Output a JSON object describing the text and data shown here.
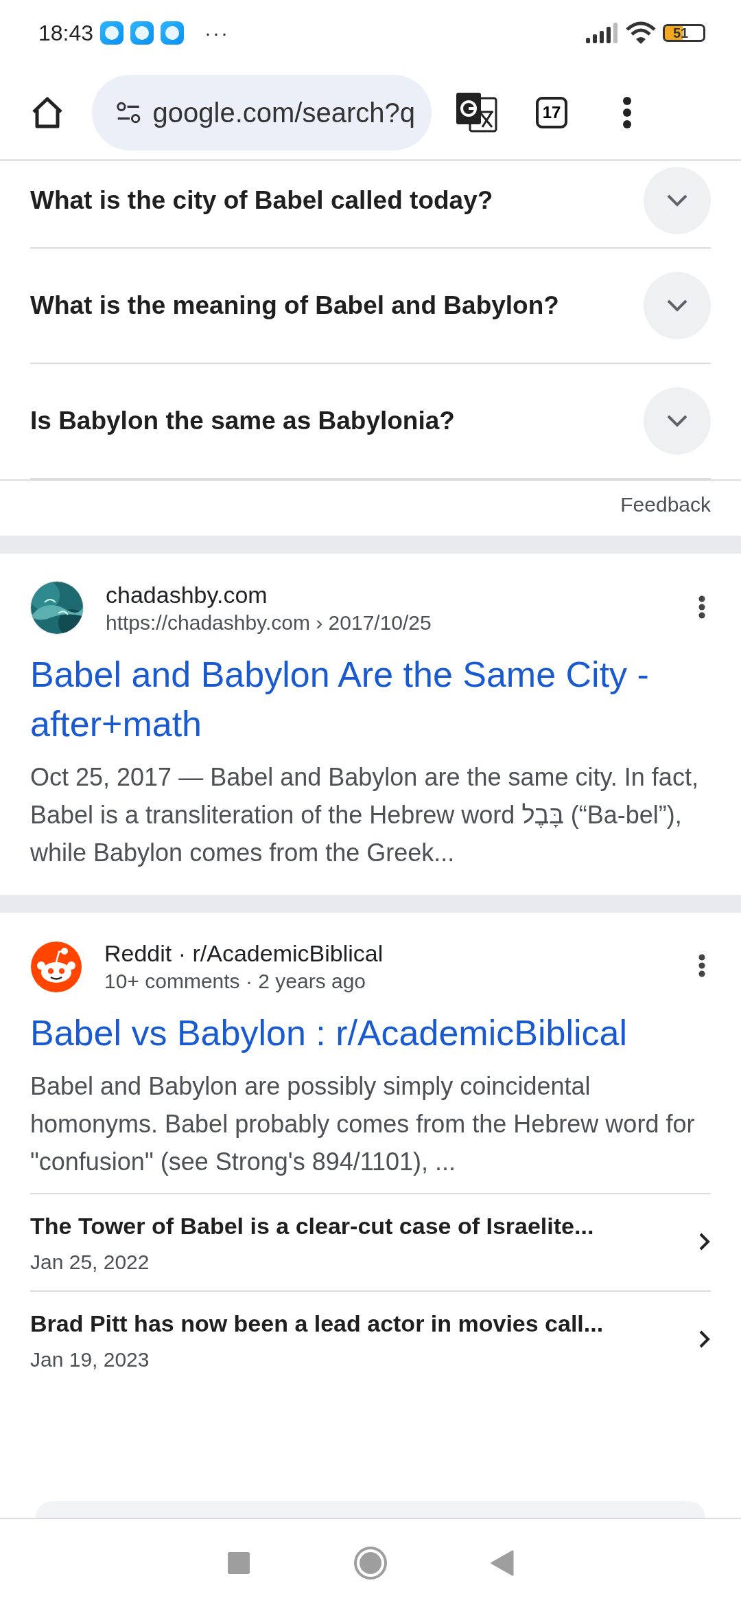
{
  "status_bar": {
    "time": "18:43",
    "overflow": "···",
    "battery": "51"
  },
  "toolbar": {
    "url": "google.com/search?q",
    "tab_count": "17"
  },
  "faq": {
    "questions": [
      {
        "text": "What is the city of Babel called today?",
        "expanded": false
      },
      {
        "text": "What is the meaning of Babel and Babylon?",
        "expanded": false
      },
      {
        "text": "Is Babylon the same as Babylonia?",
        "expanded": false
      }
    ],
    "feedback": "Feedback"
  },
  "results": [
    {
      "kind": "picture",
      "site": "chadashby.com",
      "meta": "https://chadashby.com › 2017/10/25",
      "title": "Babel and Babylon Are the Same City - after+math",
      "snippet": "Oct 25, 2017 — Babel and Babylon are the same city. In fact, Babel is a transliteration of the Hebrew word בָּבֶל (“Ba-bel”), while Babylon comes from the Greek..."
    },
    {
      "kind": "reddit",
      "site": "Reddit · r/AcademicBiblical",
      "meta": "10+ comments · 2 years ago",
      "title": "Babel vs Babylon : r/AcademicBiblical",
      "snippet": "Babel and Babylon are possibly simply coincidental homonyms. Babel probably comes from the Hebrew word for \"confusion\" (see Strong's 894/1101), ...",
      "sublinks": [
        {
          "title": "The Tower of Babel is a clear-cut case of Israelite...",
          "date": "Jan 25, 2022"
        },
        {
          "title": "Brad Pitt has now been a lead actor in movies call...",
          "date": "Jan 19, 2023"
        }
      ]
    }
  ]
}
